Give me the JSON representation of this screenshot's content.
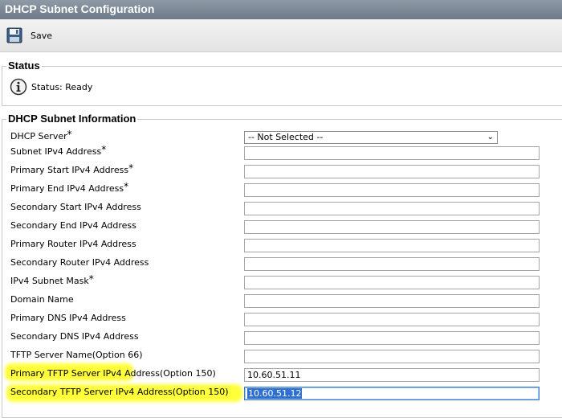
{
  "window": {
    "title": "DHCP Subnet Configuration"
  },
  "toolbar": {
    "save_label": "Save",
    "save_icon": "floppy-disk-icon"
  },
  "status": {
    "legend": "Status",
    "text": "Status: Ready",
    "icon": "info-icon"
  },
  "subnet_info": {
    "legend": "DHCP Subnet Information",
    "dhcp_server": {
      "label": "DHCP Server",
      "required": "*",
      "selected": "-- Not Selected --"
    },
    "fields": [
      {
        "label": "Subnet IPv4 Address",
        "required": "*",
        "value": ""
      },
      {
        "label": "Primary Start IPv4 Address",
        "required": "*",
        "value": ""
      },
      {
        "label": "Primary End IPv4 Address",
        "required": "*",
        "value": ""
      },
      {
        "label": "Secondary Start IPv4 Address",
        "required": "",
        "value": ""
      },
      {
        "label": "Secondary End IPv4 Address",
        "required": "",
        "value": ""
      },
      {
        "label": "Primary Router IPv4 Address",
        "required": "",
        "value": ""
      },
      {
        "label": "Secondary Router IPv4 Address",
        "required": "",
        "value": ""
      },
      {
        "label": "IPv4 Subnet Mask",
        "required": "*",
        "value": ""
      },
      {
        "label": "Domain Name",
        "required": "",
        "value": ""
      },
      {
        "label": "Primary DNS IPv4 Address",
        "required": "",
        "value": ""
      },
      {
        "label": "Secondary DNS IPv4 Address",
        "required": "",
        "value": ""
      },
      {
        "label": "TFTP Server Name(Option 66)",
        "required": "",
        "value": ""
      },
      {
        "label": "Primary TFTP Server IPv4 Address(Option 150)",
        "required": "",
        "value": "10.60.51.11"
      },
      {
        "label": "Secondary TFTP Server IPv4 Address(Option 150)",
        "required": "",
        "value": "10.60.51.12"
      }
    ]
  },
  "colors": {
    "highlight": "#ffff3a",
    "titlebar": "#7b8794",
    "selection": "#2f6fd0"
  }
}
